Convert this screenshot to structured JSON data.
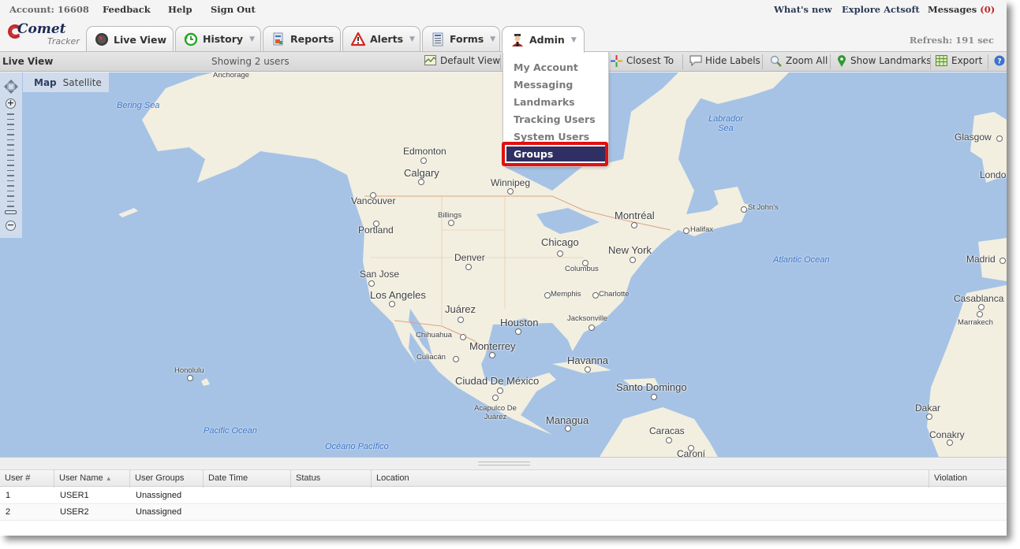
{
  "toplinks": {
    "account": "Account: 16608",
    "feedback": "Feedback",
    "help": "Help",
    "signout": "Sign Out",
    "whatsnew": "What's new",
    "explore": "Explore Actsoft",
    "messages_label": "Messages",
    "messages_count": "(0)"
  },
  "logo": {
    "brand": "Comet",
    "product": "Tracker"
  },
  "tabs": [
    {
      "label": "Live View",
      "icon": "speedometer-icon",
      "active": true,
      "has_dropdown": false
    },
    {
      "label": "History",
      "icon": "clock-icon",
      "has_dropdown": true
    },
    {
      "label": "Reports",
      "icon": "report-icon",
      "has_dropdown": false
    },
    {
      "label": "Alerts",
      "icon": "warning-icon",
      "has_dropdown": true
    },
    {
      "label": "Forms",
      "icon": "document-icon",
      "has_dropdown": true
    },
    {
      "label": "Admin",
      "icon": "admin-user-icon",
      "has_dropdown": true,
      "open": true
    }
  ],
  "refresh": "Refresh: 191 sec",
  "toolbar": {
    "title": "Live View",
    "showing": "Showing 2 users",
    "buttons": [
      {
        "label": "Default View",
        "icon": "map-view-icon"
      },
      {
        "label": "Closest To",
        "icon": "crosshair-icon"
      },
      {
        "label": "Hide Labels",
        "icon": "speech-bubble-icon"
      },
      {
        "label": "Zoom All",
        "icon": "magnifier-icon"
      },
      {
        "label": "Show Landmarks",
        "icon": "map-pin-icon"
      },
      {
        "label": "Export",
        "icon": "spreadsheet-icon"
      }
    ],
    "help_icon": "help-icon"
  },
  "admin_menu": {
    "items": [
      "My Account",
      "Messaging",
      "Landmarks",
      "Tracking Users",
      "System Users",
      "Groups"
    ],
    "selected": "Groups"
  },
  "map": {
    "types": [
      "Map",
      "Satellite"
    ],
    "selected_type": "Map",
    "cities": [
      "Anchorage",
      "Edmonton",
      "Calgary",
      "Winnipeg",
      "Vancouver",
      "Billings",
      "Portland",
      "Montréal",
      "St John's",
      "Halifax",
      "Chicago",
      "New York",
      "Denver",
      "Columbus",
      "San Jose",
      "Los Angeles",
      "Memphis",
      "Charlotte",
      "Juárez",
      "Houston",
      "Jacksonville",
      "Chihuahua",
      "Monterrey",
      "Culiacán",
      "Havanna",
      "Ciudad De México",
      "Santo Domingo",
      "Acapulco De Juárez",
      "Managua",
      "Caracas",
      "Caroní",
      "Honolulu",
      "Glasgow",
      "London",
      "Madrid",
      "Casablanca",
      "Marrakech",
      "Dakar",
      "Conakry"
    ],
    "water": [
      "Bering Sea",
      "Labrador Sea",
      "Atlantic Ocean",
      "Pacific Ocean",
      "Océano Pacífico"
    ]
  },
  "grid": {
    "columns": [
      "User #",
      "User Name",
      "User Groups",
      "Date Time",
      "Status",
      "Location",
      "Violation"
    ],
    "sort_column": "User Name",
    "sort_indicator": "▲",
    "rows": [
      {
        "num": "1",
        "name": "USER1",
        "groups": "Unassigned",
        "datetime": "",
        "status": "",
        "location": "",
        "violation": ""
      },
      {
        "num": "2",
        "name": "USER2",
        "groups": "Unassigned",
        "datetime": "",
        "status": "",
        "location": "",
        "violation": ""
      }
    ]
  }
}
